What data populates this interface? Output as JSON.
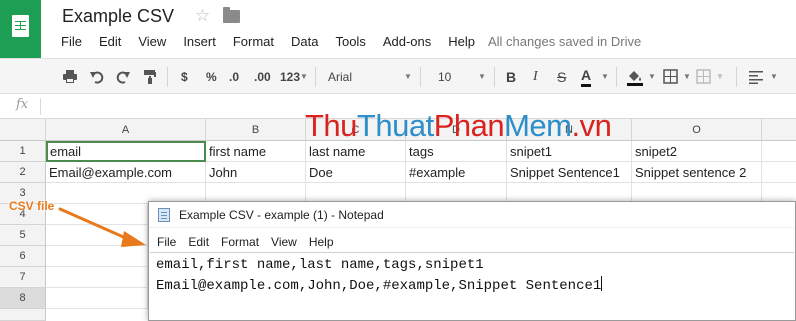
{
  "app": {
    "doc_title": "Example CSV",
    "save_status": "All changes saved in Drive",
    "menu": [
      "File",
      "Edit",
      "View",
      "Insert",
      "Format",
      "Data",
      "Tools",
      "Add-ons",
      "Help"
    ]
  },
  "toolbar": {
    "currency": "$",
    "percent": "%",
    "decrease_decimals": ".0",
    "increase_decimals": ".00",
    "more_formats": "123",
    "font": "Arial",
    "font_size": "10",
    "bold": "B",
    "italic": "I",
    "strikethrough": "S",
    "text_color": "A"
  },
  "formula_bar": {
    "label": "fx",
    "value": ""
  },
  "sheet": {
    "columns": [
      "A",
      "B",
      "C",
      "D",
      "N",
      "O"
    ],
    "rows": [
      "1",
      "2",
      "3",
      "4",
      "5",
      "6",
      "7",
      "8"
    ],
    "data": [
      [
        "email",
        "first name",
        "last name",
        "tags",
        "snipet1",
        "snipet2"
      ],
      [
        "Email@example.com",
        "John",
        "Doe",
        "#example",
        "Snippet Sentence1",
        "Snippet sentence 2"
      ]
    ],
    "selected_cell": "A1",
    "selected_row": "8"
  },
  "watermark": {
    "part1": "Thu",
    "part2": "Thuat",
    "part3": "Phan",
    "part4": "Mem",
    "part5": ".vn"
  },
  "annotation": {
    "label": "CSV file",
    "color": "#e87a1c"
  },
  "notepad": {
    "title": "Example CSV - example (1) - Notepad",
    "menu": [
      "File",
      "Edit",
      "Format",
      "View",
      "Help"
    ],
    "lines": [
      "email,first name,last name,tags,snipet1",
      "Email@example.com,John,Doe,#example,Snippet Sentence1"
    ]
  }
}
